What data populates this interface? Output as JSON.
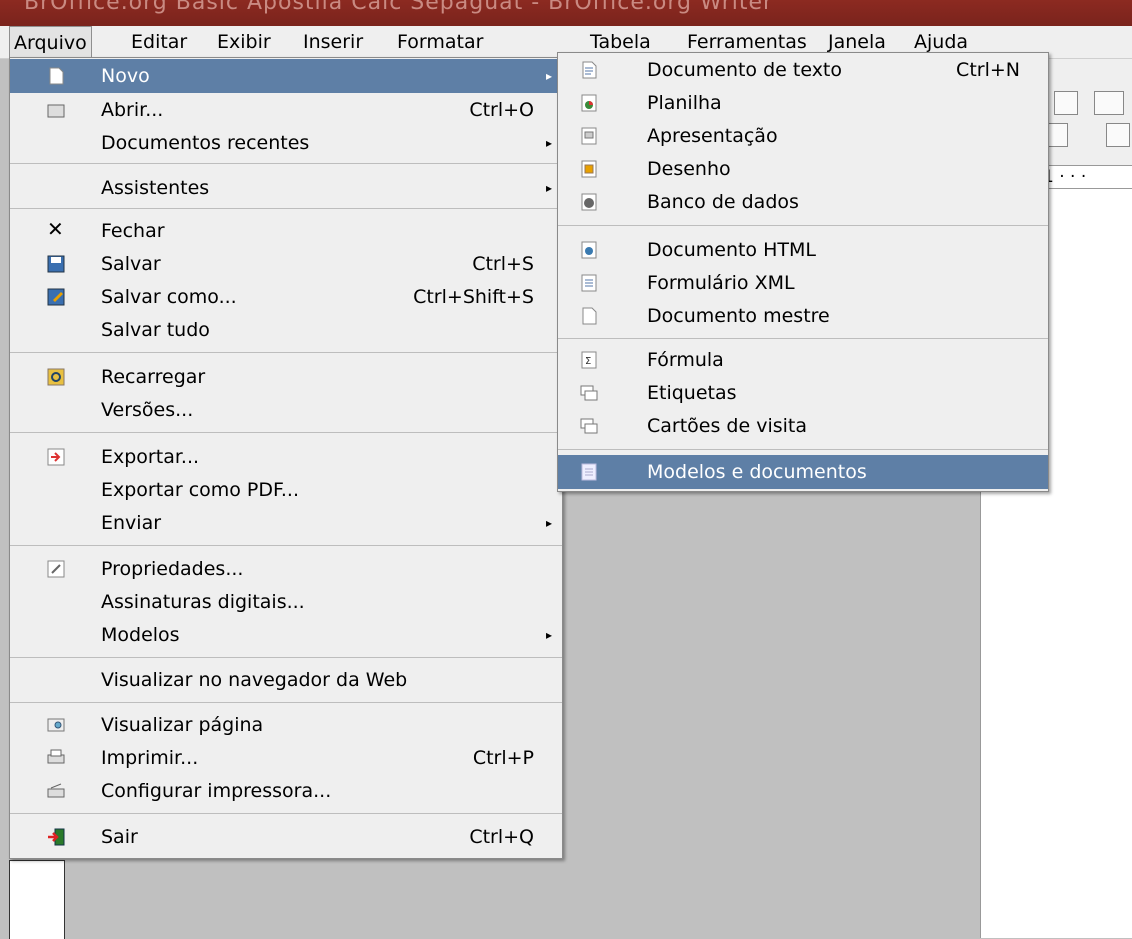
{
  "window": {
    "title": "BrOffice.org Basic Apostila Calc Sepaguat - BrOffice.org Writer"
  },
  "menubar": [
    {
      "label": "Arquivo",
      "active": true
    },
    {
      "label": "Editar"
    },
    {
      "label": "Exibir"
    },
    {
      "label": "Inserir"
    },
    {
      "label": "Formatar"
    },
    {
      "label": "Tabela"
    },
    {
      "label": "Ferramentas"
    },
    {
      "label": "Janela"
    },
    {
      "label": "Ajuda"
    }
  ],
  "arquivo_menu": {
    "items": [
      {
        "label": "Novo",
        "icon": "new-doc-icon",
        "submenu": true,
        "highlighted": true
      },
      {
        "label": "Abrir...",
        "shortcut": "Ctrl+O",
        "icon": "open-folder-icon"
      },
      {
        "label": "Documentos recentes",
        "submenu": true
      },
      {
        "label": "Assistentes",
        "submenu": true
      },
      {
        "label": "Fechar",
        "icon": "close-x-icon"
      },
      {
        "label": "Salvar",
        "shortcut": "Ctrl+S",
        "icon": "save-icon"
      },
      {
        "label": "Salvar como...",
        "shortcut": "Ctrl+Shift+S",
        "icon": "save-as-icon"
      },
      {
        "label": "Salvar tudo"
      },
      {
        "label": "Recarregar",
        "icon": "reload-icon"
      },
      {
        "label": "Versões..."
      },
      {
        "label": "Exportar...",
        "icon": "export-icon"
      },
      {
        "label": "Exportar como PDF..."
      },
      {
        "label": "Enviar",
        "submenu": true
      },
      {
        "label": "Propriedades...",
        "icon": "properties-icon"
      },
      {
        "label": "Assinaturas digitais..."
      },
      {
        "label": "Modelos",
        "submenu": true
      },
      {
        "label": "Visualizar no navegador da Web"
      },
      {
        "label": "Visualizar página",
        "icon": "page-preview-icon"
      },
      {
        "label": "Imprimir...",
        "shortcut": "Ctrl+P",
        "icon": "print-icon"
      },
      {
        "label": "Configurar impressora...",
        "icon": "printer-settings-icon"
      },
      {
        "label": "Sair",
        "shortcut": "Ctrl+Q",
        "icon": "exit-icon"
      }
    ]
  },
  "novo_submenu": {
    "items": [
      {
        "label": "Documento de texto",
        "shortcut": "Ctrl+N",
        "icon": "text-document-icon"
      },
      {
        "label": "Planilha",
        "icon": "spreadsheet-icon"
      },
      {
        "label": "Apresentação",
        "icon": "presentation-icon"
      },
      {
        "label": "Desenho",
        "icon": "drawing-icon"
      },
      {
        "label": "Banco de dados",
        "icon": "database-icon"
      },
      {
        "label": "Documento HTML",
        "icon": "html-document-icon"
      },
      {
        "label": "Formulário XML",
        "icon": "xml-form-icon"
      },
      {
        "label": "Documento mestre",
        "icon": "master-document-icon"
      },
      {
        "label": "Fórmula",
        "icon": "formula-icon"
      },
      {
        "label": "Etiquetas",
        "icon": "labels-icon"
      },
      {
        "label": "Cartões de visita",
        "icon": "business-cards-icon"
      },
      {
        "label": "Modelos e documentos",
        "icon": "templates-icon",
        "highlighted": true
      }
    ]
  },
  "ruler": {
    "text": "1 · · ·"
  },
  "colors": {
    "highlight": "#5e7fa6",
    "menu_bg": "#efefef",
    "title_bar": "#8c2a21"
  }
}
